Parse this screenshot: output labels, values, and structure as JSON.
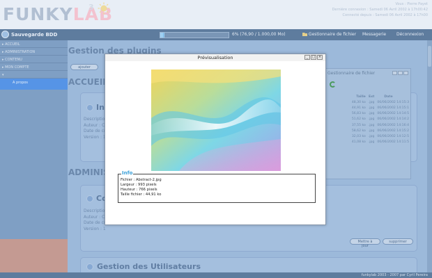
{
  "header": {
    "logo_main": "FUNKY",
    "logo_accent": "LAB",
    "logo_sup": "3",
    "info_lines": [
      "Vous : Pierre Payet",
      "Dernière connexion : Samedi 06 Avril 2002 à 17h00:42",
      "Connecté depuis : Samedi 06 Avril 2002 à 17h00"
    ]
  },
  "topbar": {
    "save_label": "Sauvegarde BDD",
    "progress_text": "6% (76,90 / 1.000,00 Mo)",
    "progress_percent": 6,
    "file_manager": "Gestionnaire de fichier",
    "messages": "Messagerie",
    "logout": "Déconnexion"
  },
  "sidebar": {
    "items": [
      "ACCUEIL",
      "ADMINISTRATION",
      "CONTENU",
      "MON COMPTE",
      "",
      "A propos"
    ]
  },
  "main": {
    "title": "Gestion des plugins",
    "add_button": "ajouter",
    "section1": "ACCUEIL",
    "card1_title": "In",
    "card1_fields": [
      "Description",
      "Auteur : Cy",
      "Date de cré",
      "Version : 1"
    ],
    "section2": "ADMINIST",
    "card2_title": "Co",
    "card2_fields": [
      "Descriptio",
      "Auteur : Cy",
      "Date de cré",
      "Version : 1"
    ],
    "update_button": "Mettre à jour",
    "delete_button": "supprimer",
    "card3_title": "Gestion des Utilisateurs"
  },
  "file_manager": {
    "title": "Gestionnaire de fichier",
    "columns": [
      "Taille",
      "Ext",
      "Date"
    ],
    "rows": [
      {
        "size": "48,30 ko",
        "ext": ".jpg",
        "date": "06/06/2002 14:15:3"
      },
      {
        "size": "44,91 ko",
        "ext": ".jpg",
        "date": "06/06/2002 14:15:1"
      },
      {
        "size": "56,83 ko",
        "ext": ".jpg",
        "date": "06/06/2002 14:14:5"
      },
      {
        "size": "51,62 ko",
        "ext": ".jpg",
        "date": "06/06/2002 14:14:2"
      },
      {
        "size": "37,55 ko",
        "ext": ".jpg",
        "date": "06/06/2002 14:16:4"
      },
      {
        "size": "58,62 ko",
        "ext": ".jpg",
        "date": "06/06/2002 14:15:2"
      },
      {
        "size": "32,03 ko",
        "ext": ".jpg",
        "date": "06/06/2002 14:12:5"
      },
      {
        "size": "41,08 ko",
        "ext": ".jpg",
        "date": "06/06/2002 14:11:5"
      }
    ]
  },
  "modal": {
    "title": "Prévisualisation",
    "info_legend": "Info",
    "info_lines": [
      "Fichier : Abstract-2.jpg",
      "Largeur : 993 pixels",
      "Hauteur : 766 pixels",
      "Taille fichier : 44,91 ko"
    ]
  },
  "footer": {
    "text": "funkylab 2003 - 2007 par Cyril Pereira"
  },
  "colors": {
    "accent": "#5694e6",
    "topbar": "#5e7c9e",
    "info_legend": "#3aa0d9"
  }
}
